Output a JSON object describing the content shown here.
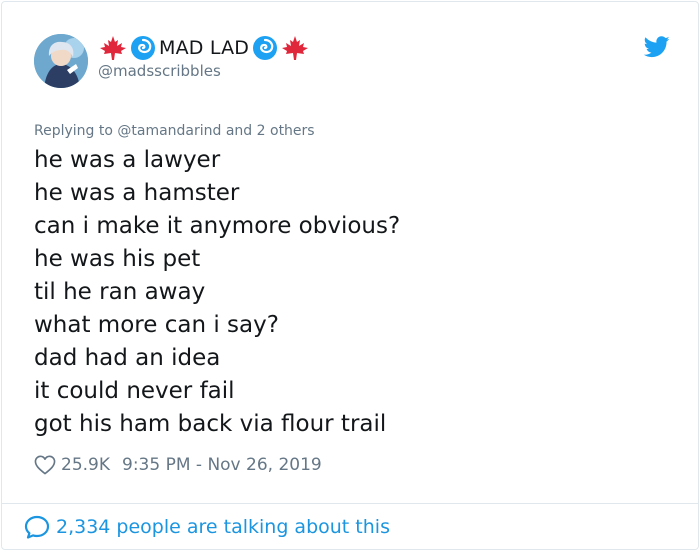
{
  "tweet": {
    "author": {
      "display_name": "MAD LAD",
      "handle": "@madsscribbles",
      "name_decorations": [
        "maple-leaf-icon",
        "cyclone-icon",
        "cyclone-icon",
        "maple-leaf-icon"
      ]
    },
    "reply_context": "Replying to @tamandarind and 2 others",
    "lines": [
      "he was a lawyer",
      "he was a hamster",
      "can i make it anymore obvious?",
      "he was his pet",
      "til he ran away",
      "what more can i say?",
      "dad had an idea",
      "it could never fail",
      "got his ham back via flour trail"
    ],
    "likes": "25.9K",
    "timestamp": "9:35 PM - Nov 26, 2019",
    "conversation": "2,334 people are talking about this"
  },
  "colors": {
    "text": "#14171a",
    "muted": "#657786",
    "accent": "#1b95e0",
    "maple": "#e0263a",
    "cyclone": "#1da1f2"
  }
}
